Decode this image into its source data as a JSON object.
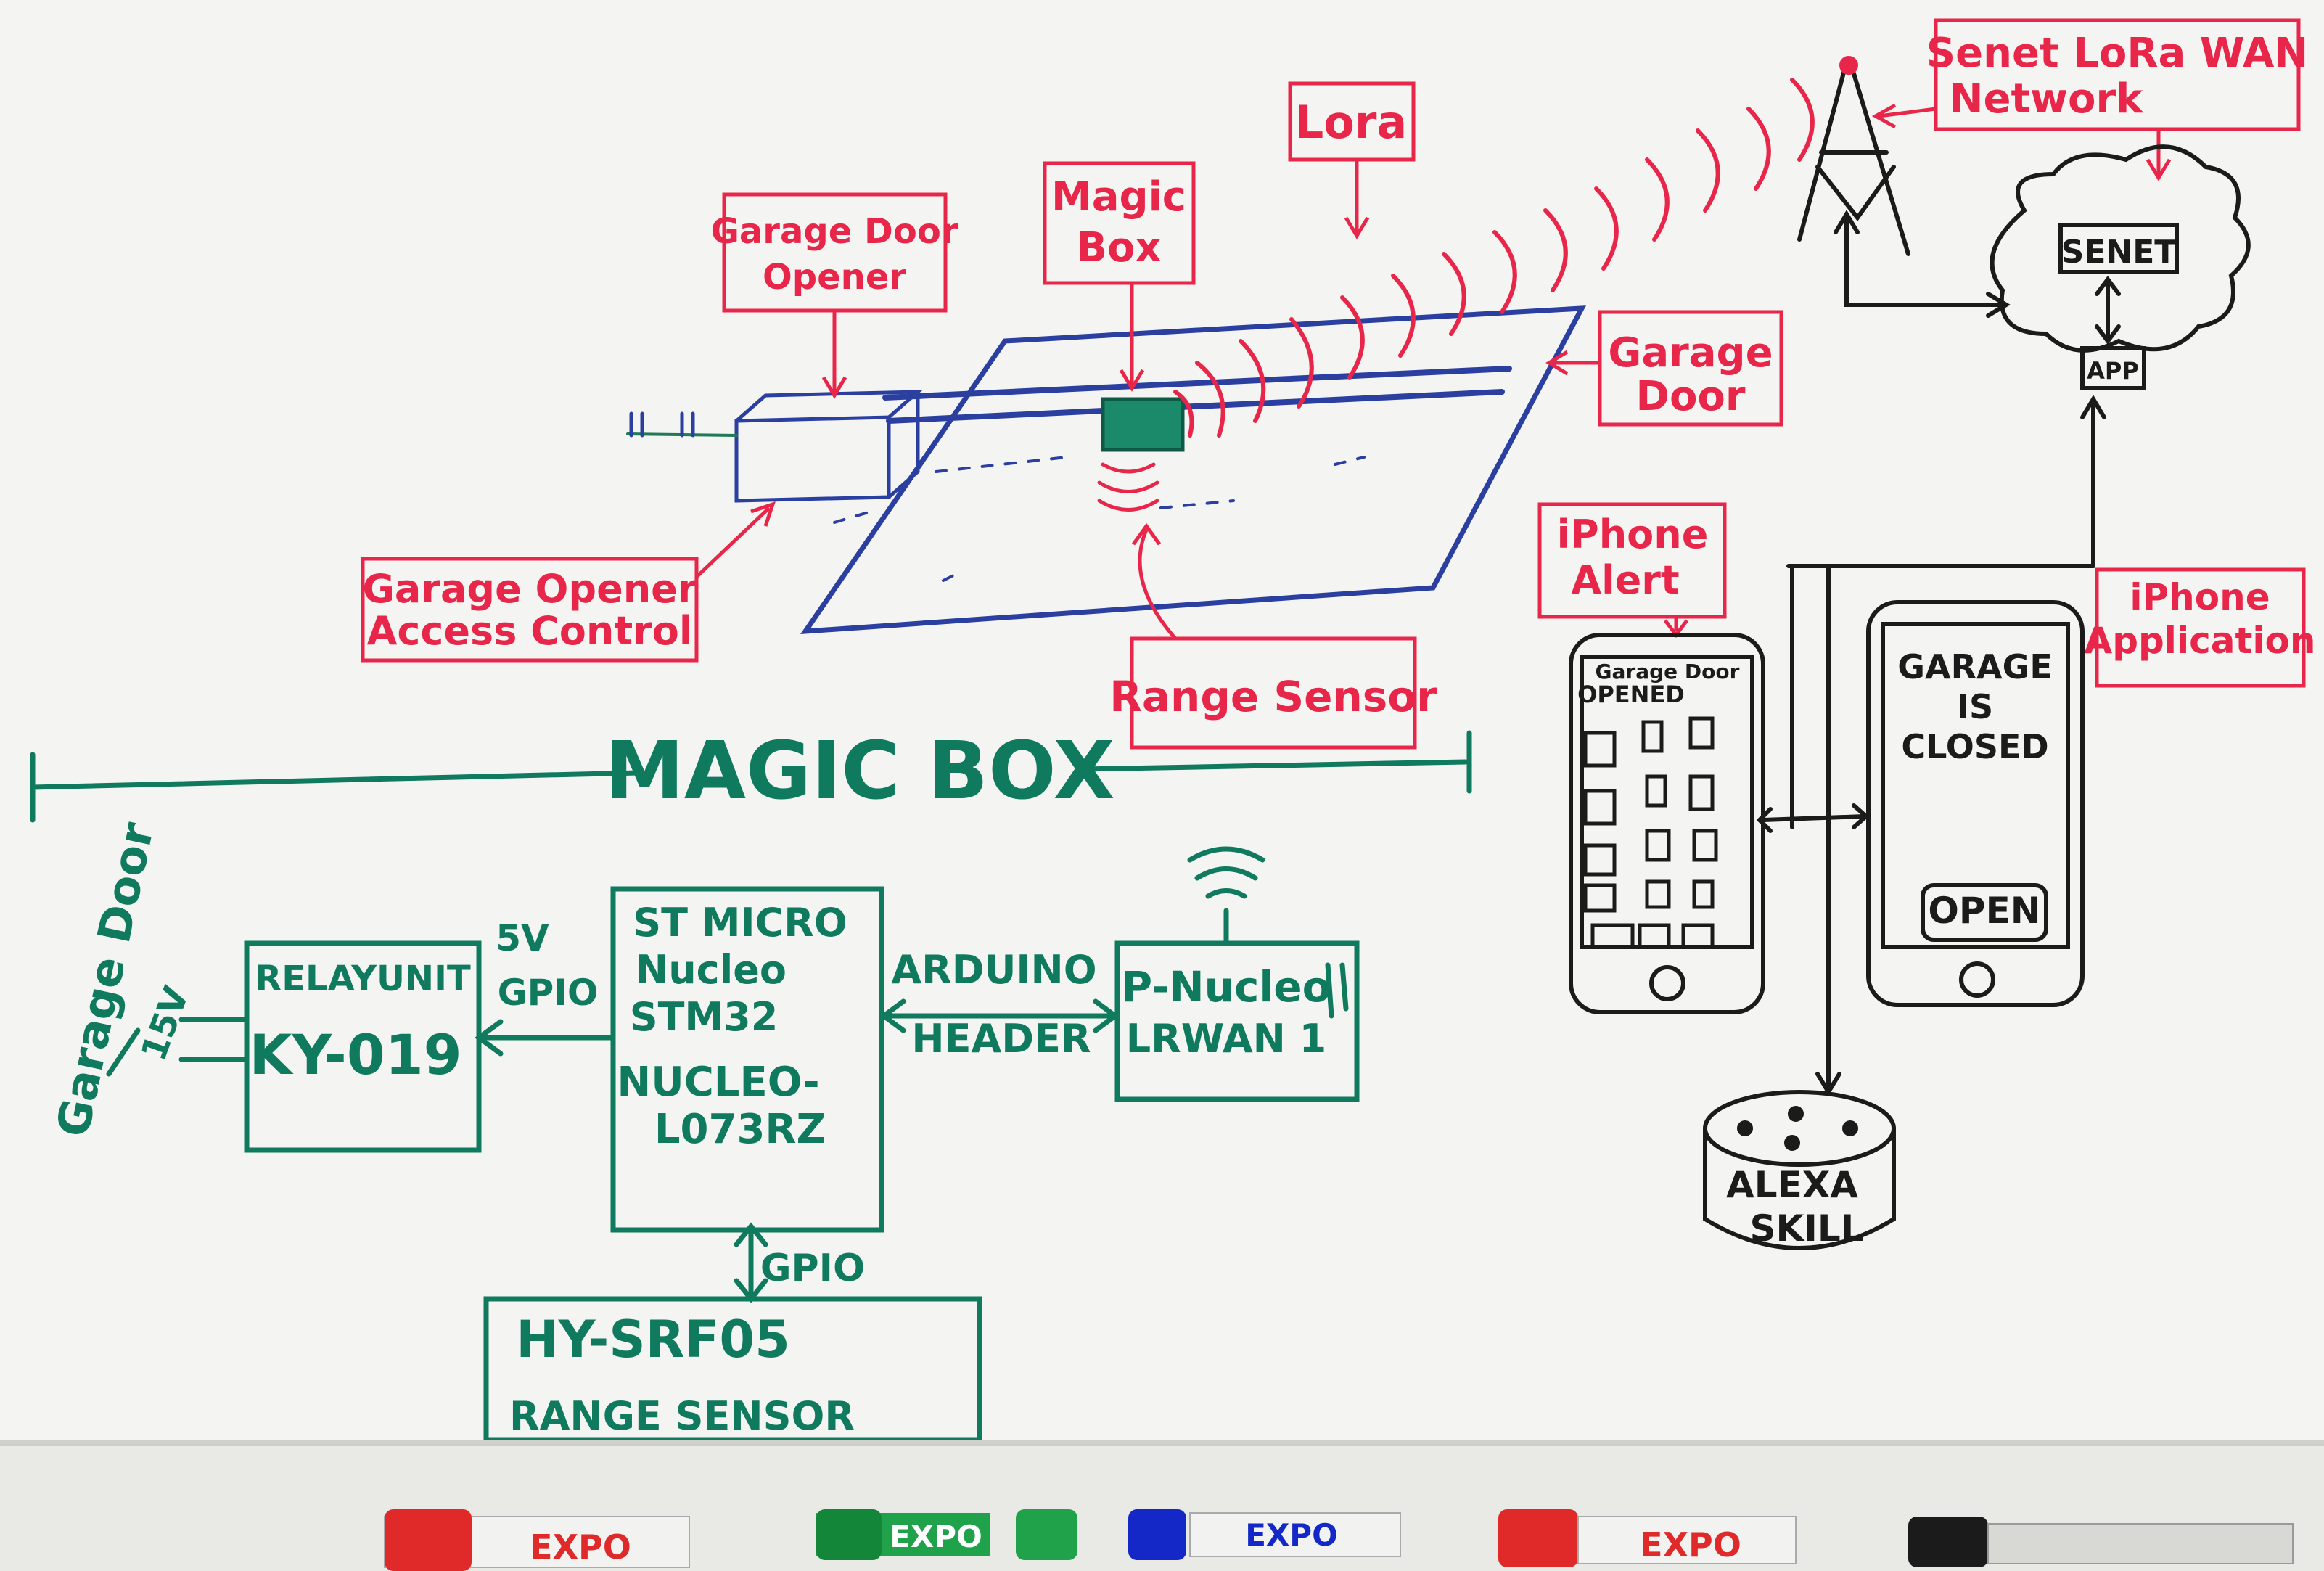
{
  "colors": {
    "red_marker": "#e8264a",
    "green_marker": "#0f7a5e",
    "blue_marker": "#2a3fa0",
    "black_marker": "#1b1b1b",
    "board": "#f4f4f2"
  },
  "labels": {
    "garage_door_opener": [
      "Garage Door",
      "Opener"
    ],
    "magic_box": [
      "Magic",
      "Box"
    ],
    "lora": "Lora",
    "senet_network": [
      "Senet LoRa WAN",
      "Network"
    ],
    "garage_door": [
      "Garage",
      "Door"
    ],
    "opener_access_control": [
      "Garage Opener",
      "Access Control"
    ],
    "range_sensor_callout": "Range Sensor",
    "iphone_alert": [
      "iPhone",
      "Alert"
    ],
    "iphone_application": [
      "iPhone",
      "Application"
    ]
  },
  "cloud": {
    "senet": "SENET",
    "app": "APP"
  },
  "phones": {
    "alert_phone_text": [
      "Garage Door",
      "OPENED"
    ],
    "app_phone_text": [
      "GARAGE",
      "IS",
      "CLOSED"
    ],
    "open_button": "OPEN"
  },
  "alexa": [
    "ALEXA",
    "SKILL"
  ],
  "block_diagram": {
    "title": "MAGIC BOX",
    "garage_door_side": "Garage Door",
    "voltage_15": "15V",
    "relay": [
      "RELAYUNIT",
      "KY-019"
    ],
    "relay_signals": [
      "5V",
      "GPIO"
    ],
    "mcu": [
      "ST MICRO",
      "Nucleo",
      "STM32",
      "NUCLEO-",
      "L073RZ"
    ],
    "bus": [
      "ARDUINO",
      "HEADER"
    ],
    "lora_board": [
      "P-Nucleo",
      "LRWAN 1"
    ],
    "gpio_bottom": "GPIO",
    "sensor": [
      "HY-SRF05",
      "RANGE SENSOR"
    ]
  },
  "markers": [
    "EXPO",
    "EXPO",
    "EXPO",
    "EXPO"
  ]
}
